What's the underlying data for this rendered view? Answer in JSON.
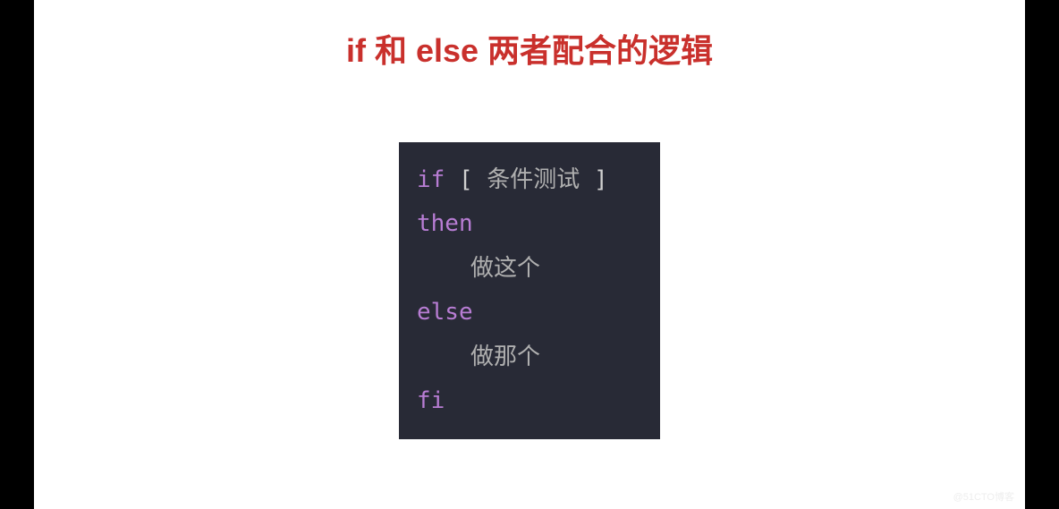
{
  "title": "if 和 else 两者配合的逻辑",
  "code": {
    "if": "if",
    "bracket_open": " [ ",
    "condition": "条件测试",
    "bracket_close": " ]",
    "then": "then",
    "do_this": "做这个",
    "else": "else",
    "do_that": "做那个",
    "fi": "fi"
  },
  "watermark": "@51CTO博客"
}
